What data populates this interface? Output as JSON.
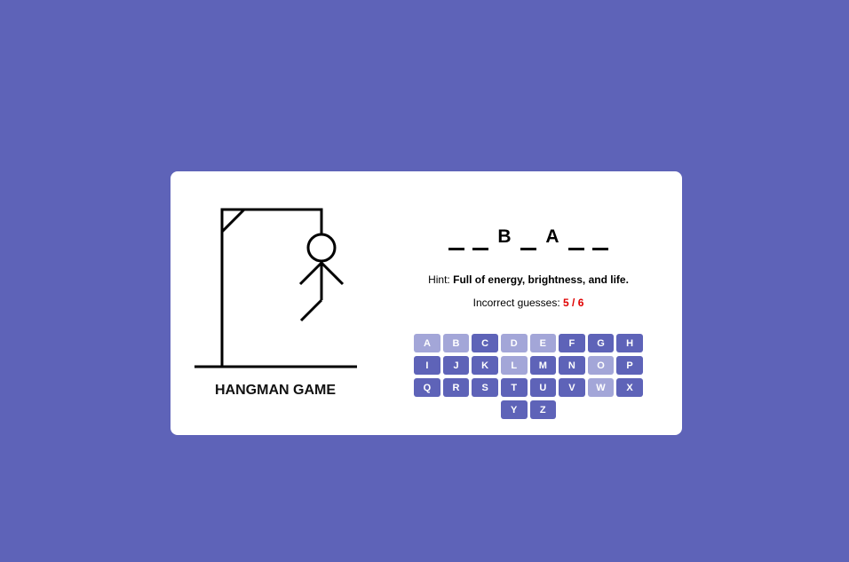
{
  "game": {
    "title": "HANGMAN GAME",
    "word_slots": [
      "",
      "",
      "B",
      "",
      "A",
      "",
      ""
    ],
    "hint_label": "Hint:",
    "hint_text": "Full of energy, brightness, and life.",
    "incorrect_label": "Incorrect guesses:",
    "incorrect_count": "5 / 6",
    "incorrect_current": 5,
    "incorrect_max": 6
  },
  "keyboard": {
    "keys": [
      {
        "letter": "A",
        "used": true
      },
      {
        "letter": "B",
        "used": true
      },
      {
        "letter": "C",
        "used": false
      },
      {
        "letter": "D",
        "used": true
      },
      {
        "letter": "E",
        "used": true
      },
      {
        "letter": "F",
        "used": false
      },
      {
        "letter": "G",
        "used": false
      },
      {
        "letter": "H",
        "used": false
      },
      {
        "letter": "I",
        "used": false
      },
      {
        "letter": "J",
        "used": false
      },
      {
        "letter": "K",
        "used": false
      },
      {
        "letter": "L",
        "used": true
      },
      {
        "letter": "M",
        "used": false
      },
      {
        "letter": "N",
        "used": false
      },
      {
        "letter": "O",
        "used": true
      },
      {
        "letter": "P",
        "used": false
      },
      {
        "letter": "Q",
        "used": false
      },
      {
        "letter": "R",
        "used": false
      },
      {
        "letter": "S",
        "used": false
      },
      {
        "letter": "T",
        "used": false
      },
      {
        "letter": "U",
        "used": false
      },
      {
        "letter": "V",
        "used": false
      },
      {
        "letter": "W",
        "used": true
      },
      {
        "letter": "X",
        "used": false
      },
      {
        "letter": "Y",
        "used": false
      },
      {
        "letter": "Z",
        "used": false
      }
    ]
  },
  "colors": {
    "background": "#5e63b8",
    "key_active": "#5e63b8",
    "key_used": "#a3a6d8",
    "incorrect_count": "#e00000"
  }
}
